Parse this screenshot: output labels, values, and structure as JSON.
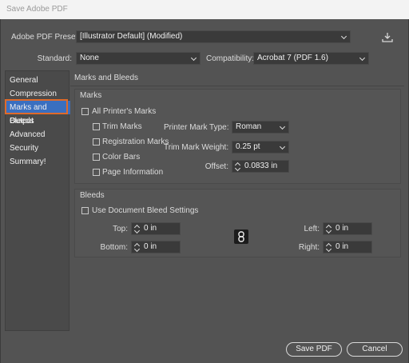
{
  "window": {
    "title": "Save Adobe PDF"
  },
  "top": {
    "preset_label": "Adobe PDF Preset:",
    "preset_value": "[Illustrator Default] (Modified)",
    "standard_label": "Standard:",
    "standard_value": "None",
    "compatibility_label": "Compatibility:",
    "compatibility_value": "Acrobat 7 (PDF 1.6)"
  },
  "sidebar": {
    "items": [
      {
        "label": "General"
      },
      {
        "label": "Compression"
      },
      {
        "label": "Marks and Bleeds"
      },
      {
        "label": "Output"
      },
      {
        "label": "Advanced"
      },
      {
        "label": "Security"
      },
      {
        "label": "Summary!"
      }
    ],
    "active": "Marks and Bleeds"
  },
  "panel": {
    "title": "Marks and Bleeds",
    "marks": {
      "heading": "Marks",
      "all_printers_marks": "All Printer's Marks",
      "trim_marks": "Trim Marks",
      "registration_marks": "Registration Marks",
      "color_bars": "Color Bars",
      "page_information": "Page Information",
      "printer_mark_type_label": "Printer Mark Type:",
      "printer_mark_type_value": "Roman",
      "trim_mark_weight_label": "Trim Mark Weight:",
      "trim_mark_weight_value": "0.25 pt",
      "offset_label": "Offset:",
      "offset_value": "0.0833 in"
    },
    "bleeds": {
      "heading": "Bleeds",
      "use_document_bleed": "Use Document Bleed Settings",
      "top_label": "Top:",
      "top_value": "0 in",
      "bottom_label": "Bottom:",
      "bottom_value": "0 in",
      "left_label": "Left:",
      "left_value": "0 in",
      "right_label": "Right:",
      "right_value": "0 in"
    }
  },
  "buttons": {
    "save": "Save PDF",
    "cancel": "Cancel"
  },
  "colors": {
    "accent": "#3a6fc0",
    "highlight": "#e06a2a",
    "background": "#535353"
  },
  "icons": [
    "save-preset-icon",
    "chevron-down-icon",
    "link-icon",
    "spinner-icon"
  ]
}
